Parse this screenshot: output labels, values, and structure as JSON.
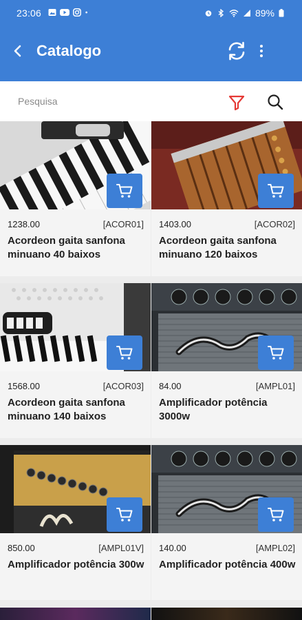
{
  "status_bar": {
    "time": "23:06",
    "battery": "89%",
    "icons": [
      "gallery-icon",
      "youtube-icon",
      "instagram-icon",
      "dot-icon",
      "alarm-icon",
      "bluetooth-icon",
      "wifi-icon",
      "signal-icon",
      "battery-icon"
    ]
  },
  "app_bar": {
    "title": "Catalogo",
    "back_icon": "back-arrow-icon",
    "sync_icon": "sync-icon",
    "more_icon": "more-vertical-icon",
    "color": "#3d7fd6"
  },
  "search": {
    "placeholder": "Pesquisa",
    "value": "",
    "filter_icon": "filter-icon",
    "filter_color": "#e53935",
    "search_icon": "search-icon"
  },
  "products": [
    {
      "price": "1238.00",
      "code": "[ACOR01]",
      "name": "Acordeon gaita sanfona minuano 40 baixos"
    },
    {
      "price": "1403.00",
      "code": "[ACOR02]",
      "name": "Acordeon gaita sanfona minuano 120 baixos"
    },
    {
      "price": "1568.00",
      "code": "[ACOR03]",
      "name": "Acordeon gaita sanfona minuano 140 baixos"
    },
    {
      "price": "84.00",
      "code": "[AMPL01]",
      "name": "Amplificador potência 3000w"
    },
    {
      "price": "850.00",
      "code": "[AMPL01V]",
      "name": "Amplificador potência 300w"
    },
    {
      "price": "140.00",
      "code": "[AMPL02]",
      "name": "Amplificador potência 400w"
    }
  ]
}
